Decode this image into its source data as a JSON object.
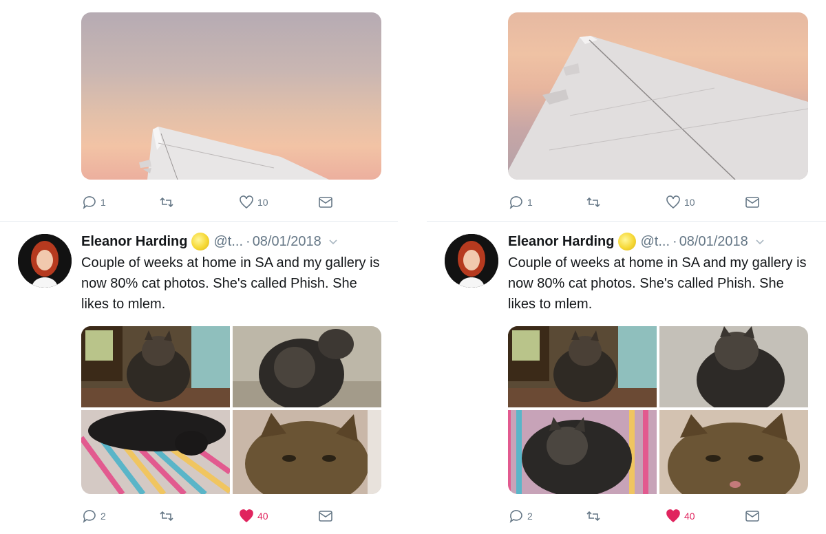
{
  "tweets": [
    {
      "top_actions": {
        "reply_count": "1",
        "retweet_count": "",
        "like_count": "10"
      },
      "author": {
        "name": "Eleanor Harding",
        "handle": "@t...",
        "separator": "·",
        "date": "08/01/2018"
      },
      "text": "Couple of weeks at home in SA and my gallery is now 80% cat photos. She's called Phish. She likes to mlem.",
      "bottom_actions": {
        "reply_count": "2",
        "retweet_count": "",
        "like_count": "40",
        "liked": true
      }
    },
    {
      "top_actions": {
        "reply_count": "1",
        "retweet_count": "",
        "like_count": "10"
      },
      "author": {
        "name": "Eleanor Harding",
        "handle": "@t...",
        "separator": "·",
        "date": "08/01/2018"
      },
      "text": "Couple of weeks at home in SA and my gallery is now 80% cat photos. She's called Phish. She likes to mlem.",
      "bottom_actions": {
        "reply_count": "2",
        "retweet_count": "",
        "like_count": "40",
        "liked": true
      }
    }
  ],
  "icons": {
    "reply": "reply-icon",
    "retweet": "retweet-icon",
    "like": "heart-icon",
    "dm": "mail-icon",
    "verified": "verified-badge-icon",
    "caret": "chevron-down-icon"
  },
  "colors": {
    "text_primary": "#14171a",
    "text_secondary": "#657786",
    "like_active": "#e0245e",
    "divider": "#e6ecf0"
  }
}
